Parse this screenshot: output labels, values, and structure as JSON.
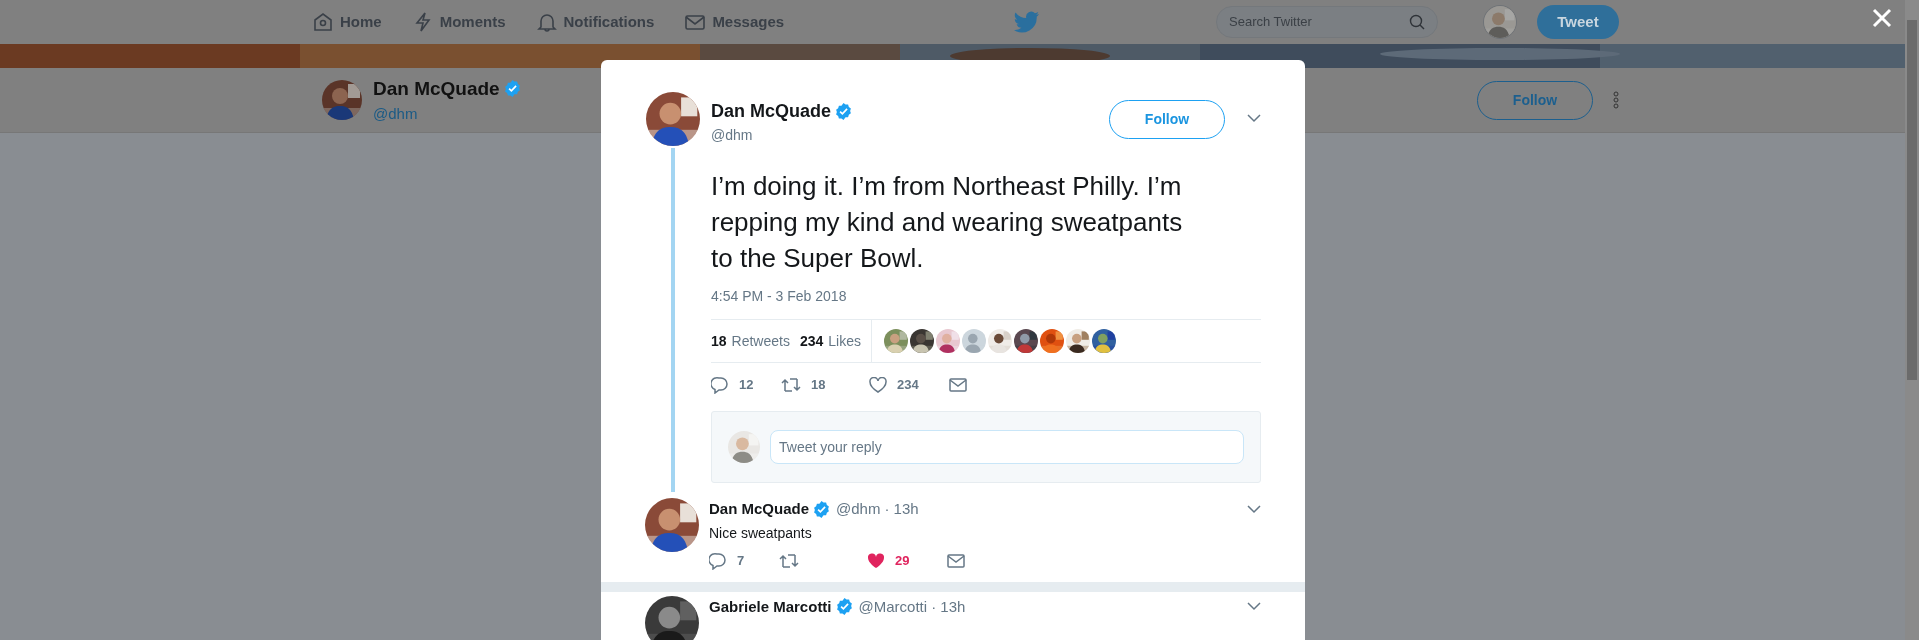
{
  "nav": {
    "items": [
      {
        "kind": "home",
        "label": "Home"
      },
      {
        "kind": "moments",
        "label": "Moments"
      },
      {
        "kind": "notifications",
        "label": "Notifications"
      },
      {
        "kind": "messages",
        "label": "Messages"
      }
    ]
  },
  "search": {
    "placeholder": "Search Twitter"
  },
  "tweet_button": "Tweet",
  "profile_bar": {
    "name": "Dan McQuade",
    "verified": true,
    "handle": "@dhm",
    "follow_button": "Follow"
  },
  "tweet": {
    "name": "Dan McQuade",
    "verified": true,
    "handle": "@dhm",
    "follow_button": "Follow",
    "text": "I’m doing it. I’m from Northeast Philly. I’m repping my kind and wearing sweatpants to the Super Bowl.",
    "timestamp": "4:54 PM - 3 Feb 2018",
    "stats": [
      {
        "count": "18",
        "label": "Retweets"
      },
      {
        "count": "234",
        "label": "Likes"
      }
    ],
    "actions": {
      "replies": "12",
      "retweets": "18",
      "likes": "234",
      "liked": false
    }
  },
  "reply_box": {
    "placeholder": "Tweet your reply"
  },
  "replies": [
    {
      "name": "Dan McQuade",
      "verified": true,
      "handle": "@dhm",
      "time": "· 13h",
      "text": "Nice sweatpants",
      "actions": {
        "replies": "7",
        "likes": "29",
        "liked": true
      }
    },
    {
      "name": "Gabriele Marcotti",
      "verified": true,
      "handle": "@Marcotti",
      "time": "· 13h"
    }
  ]
}
